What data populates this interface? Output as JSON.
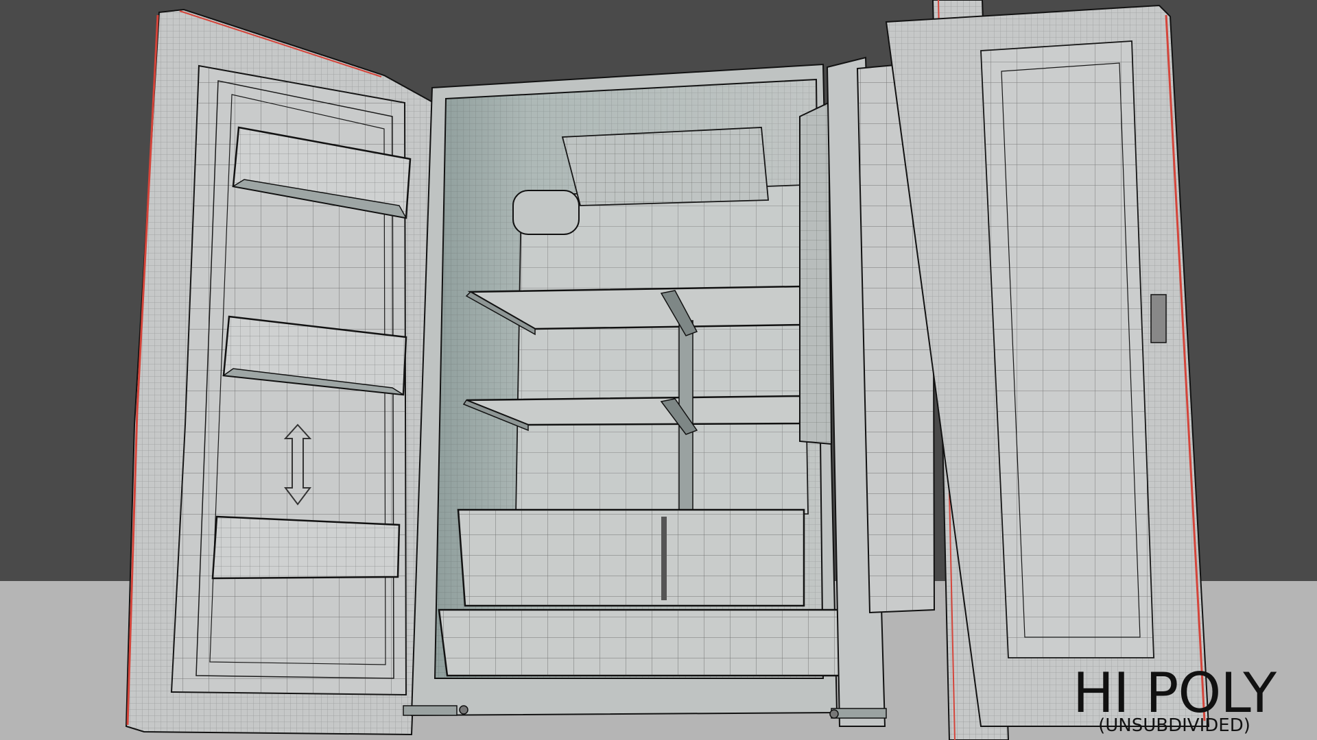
{
  "overlay": {
    "title": "HI POLY",
    "subtitle": "(UNSUBDIVIDED)"
  },
  "colors": {
    "background": "#4a4a4a",
    "floor": "#b6b6b6",
    "mesh_fill": "#c4c6c6",
    "mesh_fill_shadow": "#a9b0af",
    "wire": "#1c1c1c",
    "edge_highlight": "#d4443a",
    "interior_tint": "#9aa7a5"
  },
  "scene": {
    "subject": "refrigerator-3d-wireframe",
    "view": "viewport-render"
  }
}
